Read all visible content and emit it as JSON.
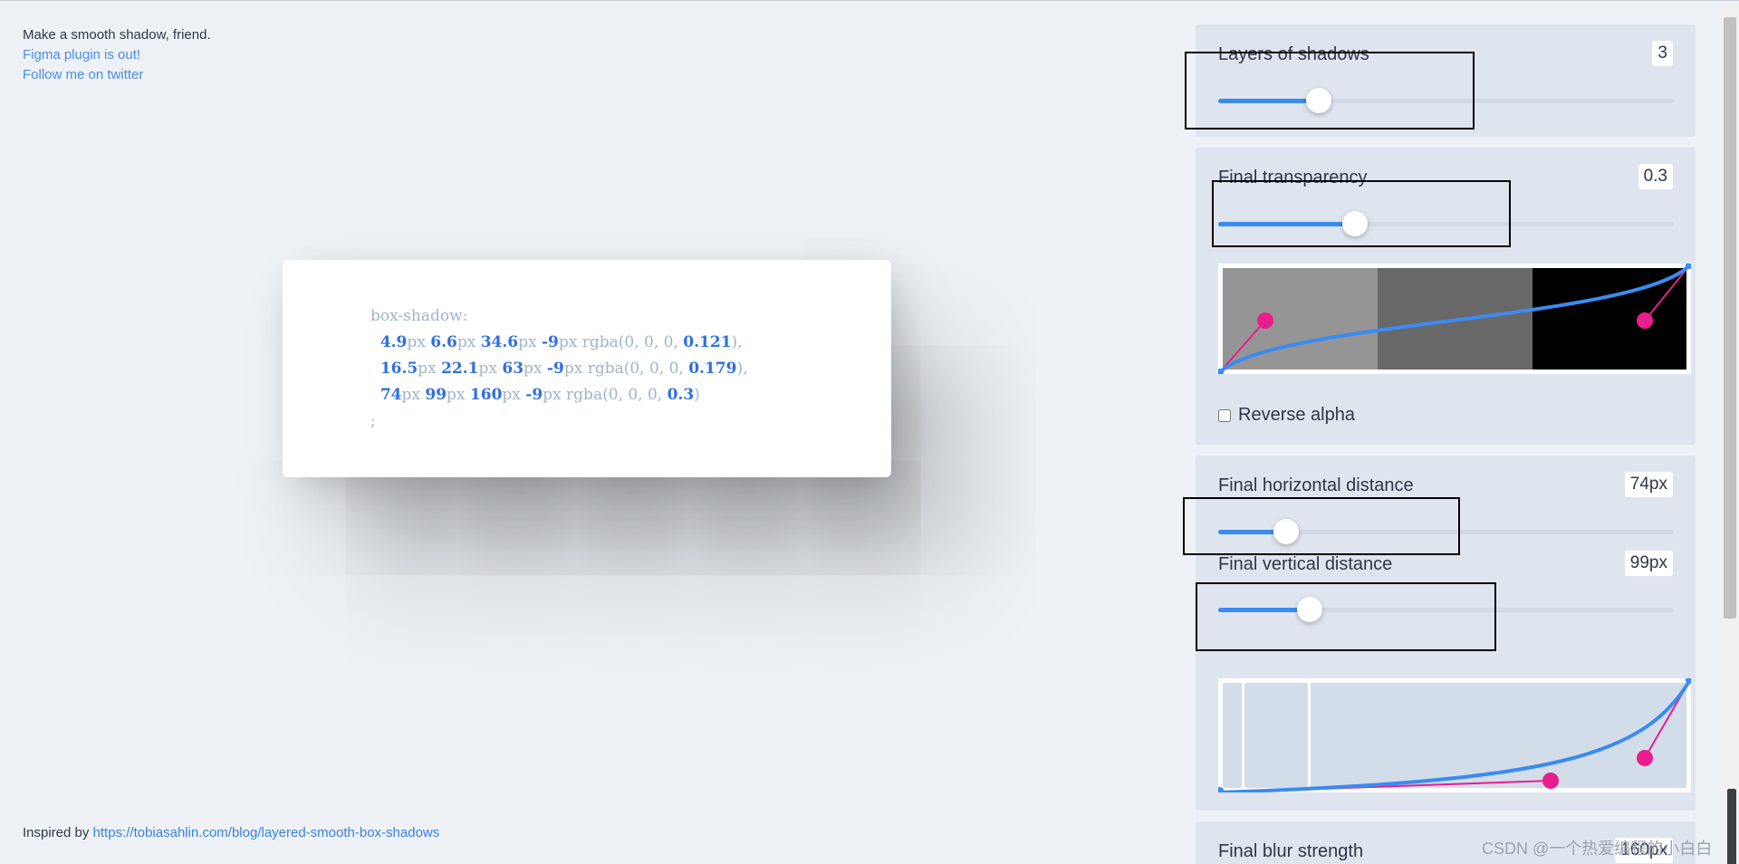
{
  "info": {
    "tagline": "Make a smooth shadow, friend.",
    "figma_link": "Figma plugin is out!",
    "twitter_link": "Follow me on twitter"
  },
  "code": {
    "prop": "box-shadow:",
    "lines": [
      [
        "4.9",
        "6.6",
        "34.6",
        "-9",
        "0.121",
        "),"
      ],
      [
        "16.5",
        "22.1",
        "63",
        "-9",
        "0.179",
        "),"
      ],
      [
        "74",
        "99",
        "160",
        "-9",
        "0.3",
        ")"
      ]
    ],
    "px": "px",
    "rgba_prefix": "rgba(0, 0, 0, ",
    "end": ";"
  },
  "controls": {
    "layers": {
      "label": "Layers of shadows",
      "value": "3",
      "fraction": 0.22
    },
    "transparency": {
      "label": "Final transparency",
      "value": "0.3",
      "fraction": 0.3
    },
    "reverse_alpha": {
      "label": "Reverse alpha",
      "checked": false
    },
    "horizontal": {
      "label": "Final horizontal distance",
      "value": "74px",
      "fraction": 0.15
    },
    "vertical": {
      "label": "Final vertical distance",
      "value": "99px",
      "fraction": 0.2
    },
    "blur": {
      "label": "Final blur strength",
      "value": "160px"
    }
  },
  "footer": {
    "prefix": "Inspired by ",
    "link": "https://tobiasahlin.com/blog/layered-smooth-box-shadows"
  },
  "watermark": "CSDN @一个热爱编程的小白白",
  "colors": {
    "accent": "#3b8bf0",
    "handle": "#e91e8c",
    "panel_bg": "#dfe5ee",
    "page_bg": "#eef2f6"
  }
}
